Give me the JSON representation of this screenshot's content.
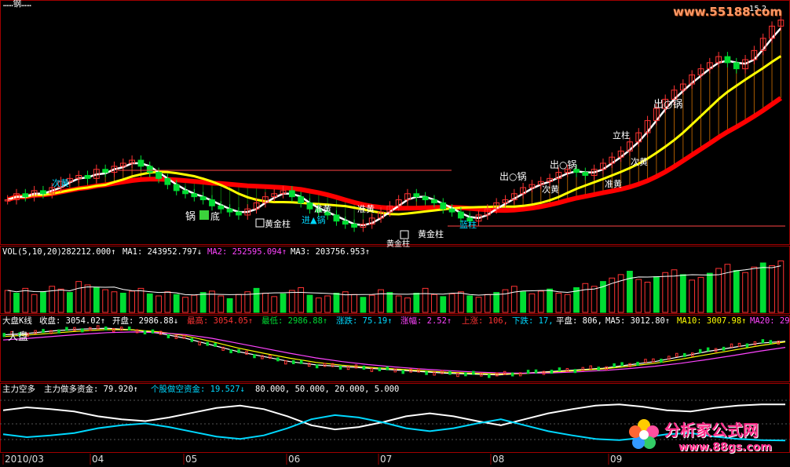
{
  "colors": {
    "up": "#ff3333",
    "down": "#00dd33",
    "frame": "#a00000",
    "white_ma": "#ffffff",
    "yellow_ma": "#ffff00",
    "red_ma": "#ff0000",
    "index_line": "#ffffff",
    "ma5": "#ffffff",
    "ma10": "#ffff00",
    "ma20": "#ff44ff",
    "cyan": "#00d8ff"
  },
  "header": {
    "title": "……钢……"
  },
  "volume_header": {
    "label": "VOL(5,10,20)",
    "vol": "282212.000↑",
    "ma1": "MA1: 243952.797↓",
    "ma2": "MA2: 252595.094↑",
    "ma3": "MA3: 203756.953↑"
  },
  "index_header": {
    "label": "大盘K线",
    "close": "收盘: 3054.02↑",
    "open": "开盘: 2986.88↓",
    "high": "最高: 3054.05↑",
    "low": "最低: 2986.88↑",
    "change": "涨跌: 75.19↑",
    "pct": "涨幅: 2.52↑",
    "up_count": "上涨: 106,",
    "down_count": "下跌: 17,",
    "flat_count": "平盘: 806,",
    "ma5": "MA5: 3012.80↑",
    "ma10": "MA10: 3007.98↑",
    "ma20": "MA20: 29",
    "inner_label": "大盘"
  },
  "flow_header": {
    "label": "主力空多",
    "main": "主力做多资金: 79.920↑",
    "retail": "个股做空资金: 19.527↓",
    "levels": "80.000, 50.000, 20.000, 5.000"
  },
  "x_axis": {
    "labels": [
      "2010/03",
      "04",
      "05",
      "06",
      "07",
      "08",
      "09"
    ]
  },
  "annotations": {
    "pot_bottom": "锅",
    "bottom": "底",
    "huangjin1": "黄金柱",
    "huangjin2": "黄金柱",
    "huangjin3": "黄金柱",
    "zhun_huang1": "准黄",
    "zhun_huang2": "准黄",
    "zhun_huang3": "准黄",
    "ci_huang1": "次黄",
    "ci_huang2": "次黄",
    "ci_huang3": "次黄",
    "chu_guo1": "出○锅",
    "chu_guo2": "出○锅",
    "chu_guo3": "出○锅",
    "jin_guo": "进▲锅",
    "li_zhu": "立柱",
    "lan_zhu": "蓝柱",
    "price_tag": "15.2"
  },
  "watermark": {
    "top": "www.55188.com",
    "bottom_title": "分析家公式网",
    "bottom_url": "www.88gs.com"
  },
  "chart_data": [
    {
      "type": "candlestick",
      "panel": "price",
      "series": [
        {
          "name": "close",
          "values": [
            9.3,
            9.5,
            9.4,
            9.6,
            9.5,
            9.7,
            9.9,
            10.0,
            10.1,
            10.0,
            10.3,
            10.2,
            10.4,
            10.5,
            10.6,
            10.4,
            10.2,
            10.0,
            9.8,
            9.6,
            9.5,
            9.4,
            9.3,
            9.1,
            9.0,
            8.9,
            8.8,
            9.0,
            9.2,
            9.4,
            9.5,
            9.6,
            9.4,
            9.2,
            9.0,
            8.9,
            8.8,
            8.6,
            8.5,
            8.4,
            8.5,
            8.7,
            8.9,
            9.1,
            9.3,
            9.5,
            9.4,
            9.3,
            9.2,
            9.0,
            8.9,
            8.7,
            8.6,
            8.8,
            9.0,
            9.2,
            9.3,
            9.5,
            9.7,
            9.8,
            9.9,
            10.0,
            10.2,
            10.3,
            10.2,
            10.1,
            10.3,
            10.5,
            10.7,
            10.9,
            11.2,
            11.5,
            11.9,
            12.3,
            12.6,
            12.9,
            13.1,
            13.4,
            13.6,
            13.8,
            14.0,
            13.8,
            13.6,
            13.9,
            14.2,
            14.6,
            15.0,
            15.2
          ]
        }
      ]
    },
    {
      "type": "bar",
      "panel": "volume",
      "values": [
        32,
        28,
        35,
        26,
        30,
        38,
        34,
        29,
        45,
        40,
        36,
        33,
        30,
        28,
        31,
        35,
        27,
        24,
        30,
        26,
        22,
        25,
        29,
        31,
        24,
        20,
        26,
        30,
        35,
        28,
        23,
        27,
        32,
        36,
        25,
        21,
        24,
        28,
        30,
        26,
        22,
        25,
        33,
        29,
        24,
        21,
        28,
        35,
        26,
        23,
        27,
        30,
        24,
        22,
        26,
        29,
        33,
        38,
        30,
        27,
        31,
        34,
        28,
        26,
        36,
        42,
        38,
        45,
        50,
        55,
        60,
        48,
        44,
        52,
        58,
        62,
        55,
        47,
        51,
        57,
        64,
        70,
        61,
        58,
        66,
        72,
        68,
        75
      ],
      "ma1": "MA1: 243952.797↓"
    },
    {
      "type": "line",
      "panel": "index",
      "series": [
        {
          "name": "MA5",
          "values": [
            3050,
            3060,
            3075,
            3085,
            3090,
            3080,
            3060,
            3030,
            2990,
            2950,
            2920,
            2890,
            2870,
            2860,
            2850,
            2840,
            2830,
            2820,
            2815,
            2810,
            2820,
            2830,
            2840,
            2850,
            2870,
            2890,
            2920,
            2950,
            2975,
            3000,
            3012
          ]
        },
        {
          "name": "MA10",
          "values": [
            3040,
            3050,
            3062,
            3074,
            3082,
            3080,
            3068,
            3045,
            3010,
            2972,
            2940,
            2910,
            2885,
            2868,
            2856,
            2846,
            2836,
            2826,
            2820,
            2815,
            2818,
            2826,
            2836,
            2846,
            2862,
            2880,
            2904,
            2932,
            2958,
            2985,
            3008
          ]
        },
        {
          "name": "MA20",
          "values": [
            3020,
            3030,
            3042,
            3054,
            3064,
            3068,
            3064,
            3052,
            3030,
            3000,
            2970,
            2940,
            2912,
            2890,
            2872,
            2858,
            2846,
            2836,
            2828,
            2822,
            2820,
            2822,
            2828,
            2836,
            2848,
            2862,
            2880,
            2902,
            2926,
            2952,
            2975
          ]
        }
      ]
    },
    {
      "type": "line",
      "panel": "capital_flow",
      "series": [
        {
          "name": "主力做多资金",
          "values": [
            70,
            75,
            72,
            68,
            60,
            55,
            52,
            58,
            66,
            74,
            78,
            72,
            60,
            45,
            38,
            42,
            50,
            60,
            65,
            60,
            52,
            45,
            55,
            65,
            72,
            78,
            80,
            76,
            70,
            68,
            74,
            78,
            80,
            79.9
          ]
        },
        {
          "name": "个股做空资金",
          "values": [
            30,
            25,
            28,
            32,
            40,
            45,
            48,
            42,
            34,
            26,
            22,
            28,
            40,
            55,
            62,
            58,
            50,
            40,
            35,
            40,
            48,
            55,
            45,
            35,
            28,
            22,
            20,
            24,
            30,
            32,
            26,
            22,
            20,
            19.5
          ]
        }
      ]
    }
  ]
}
